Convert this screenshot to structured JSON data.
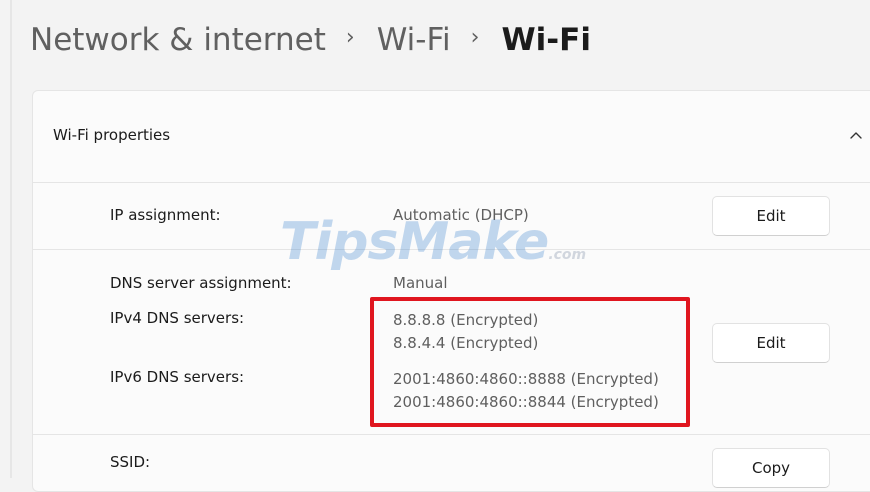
{
  "breadcrumb": {
    "items": [
      "Network & internet",
      "Wi-Fi"
    ],
    "current": "Wi-Fi",
    "separator": "›"
  },
  "section": {
    "title": "Wi-Fi properties",
    "chevron_icon": "chevron-up-icon"
  },
  "rows": {
    "ip_assignment": {
      "label": "IP assignment:",
      "value": "Automatic (DHCP)",
      "button": "Edit"
    },
    "dns_assignment": {
      "label": "DNS server assignment:",
      "value": "Manual",
      "button": "Edit"
    },
    "ipv4": {
      "label": "IPv4 DNS servers:",
      "values": [
        "8.8.8.8 (Encrypted)",
        "8.8.4.4 (Encrypted)"
      ]
    },
    "ipv6": {
      "label": "IPv6 DNS servers:",
      "values": [
        "2001:4860:4860::8888 (Encrypted)",
        "2001:4860:4860::8844 (Encrypted)"
      ]
    },
    "ssid": {
      "label": "SSID:",
      "button": "Copy"
    }
  },
  "watermark": {
    "main": "TipsMake",
    "suffix": ".com"
  },
  "colors": {
    "highlight": "#e0161f",
    "background": "#f3f3f3",
    "card": "#fbfbfb"
  }
}
